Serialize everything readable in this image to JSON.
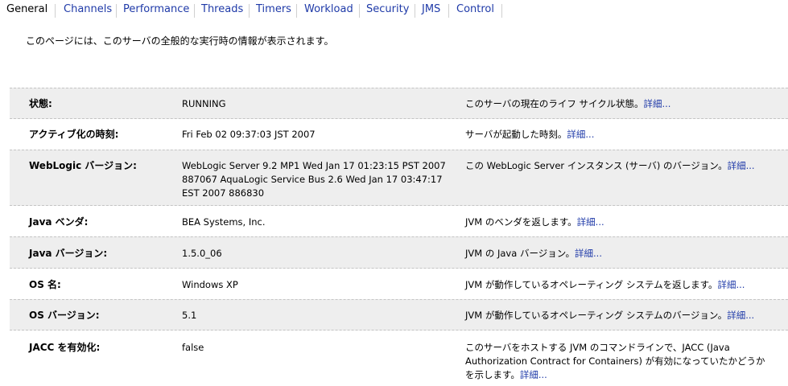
{
  "tabs": [
    {
      "label": "General",
      "active": true
    },
    {
      "label": "Channels",
      "active": false
    },
    {
      "label": "Performance",
      "active": false
    },
    {
      "label": "Threads",
      "active": false
    },
    {
      "label": "Timers",
      "active": false
    },
    {
      "label": "Workload",
      "active": false
    },
    {
      "label": "Security",
      "active": false
    },
    {
      "label": "JMS",
      "active": false
    },
    {
      "label": "Control",
      "active": false
    }
  ],
  "description": "このページには、このサーバの全般的な実行時の情報が表示されます。",
  "rows": [
    {
      "label": "状態:",
      "value": "RUNNING",
      "desc": "このサーバの現在のライフ サイクル状態。",
      "more": "詳細..."
    },
    {
      "label": "アクティブ化の時刻:",
      "value": "Fri Feb 02 09:37:03 JST 2007",
      "desc": "サーバが起動した時刻。",
      "more": "詳細..."
    },
    {
      "label": "WebLogic バージョン:",
      "value_lines": [
        "WebLogic Server 9.2 MP1 Wed Jan 17 01:23:15 PST 2007",
        "887067 AquaLogic Service Bus 2.6 Wed Jan 17 03:47:17",
        "EST 2007 886830"
      ],
      "desc": "この WebLogic Server インスタンス (サーバ) のバージョン。",
      "more": "詳細..."
    },
    {
      "label": "Java ベンダ:",
      "value": "BEA Systems, Inc.",
      "desc": "JVM のベンダを返します。",
      "more": "詳細..."
    },
    {
      "label": "Java バージョン:",
      "value": "1.5.0_06",
      "desc": "JVM の Java バージョン。",
      "more": "詳細..."
    },
    {
      "label": "OS 名:",
      "value": "Windows XP",
      "desc": "JVM が動作しているオペレーティング システムを返します。",
      "more": "詳細..."
    },
    {
      "label": "OS バージョン:",
      "value": "5.1",
      "desc": "JVM が動作しているオペレーティング システムのバージョン。",
      "more": "詳細..."
    },
    {
      "label": "JACC を有効化:",
      "value": "false",
      "desc_lines": [
        "このサーバをホストする JVM のコマンドラインで、JACC (Java",
        "Authorization Contract for Containers) が有効になっていたかどうか",
        "を示します。"
      ],
      "more": "詳細..."
    }
  ]
}
